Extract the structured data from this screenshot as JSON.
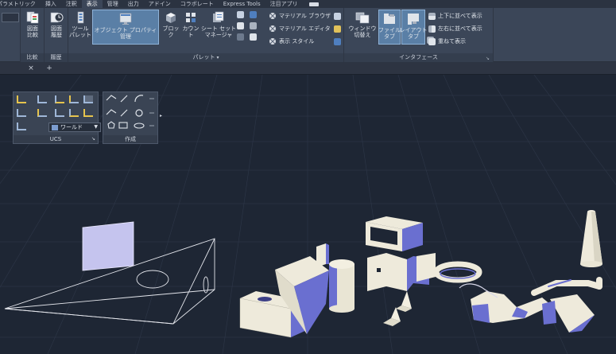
{
  "ribbon_tabs": [
    {
      "label": "パラメトリック",
      "active": false
    },
    {
      "label": "挿入",
      "active": false
    },
    {
      "label": "注釈",
      "active": false
    },
    {
      "label": "表示",
      "active": true
    },
    {
      "label": "管理",
      "active": false
    },
    {
      "label": "出力",
      "active": false
    },
    {
      "label": "アドイン",
      "active": false
    },
    {
      "label": "コラボレート",
      "active": false
    },
    {
      "label": "Express Tools",
      "active": false
    },
    {
      "label": "注目アプリ",
      "active": false
    }
  ],
  "panels": {
    "compare": {
      "title": "比較",
      "button": "図面\n比較"
    },
    "history": {
      "title": "履歴",
      "button": "図面\n履歴"
    },
    "palettes": {
      "title": "パレット",
      "tool_palette": "ツール\nパレット",
      "properties": "オブジェクト プロパティ管理",
      "block": "ブロック",
      "count": "カウント",
      "sheet_set": "シート セット\nマネージャ",
      "material_browser": "マテリアル ブラウザ",
      "material_editor": "マテリアル エディタ",
      "visual_styles": "表示 スタイル"
    },
    "interface": {
      "title": "インタフェース",
      "switch_windows": "ウィンドウ\n切替え",
      "file_tabs": "ファイル\nタブ",
      "layout_tabs": "レイアウト\nタブ",
      "tile_horizontal": "上下に並べて表示",
      "tile_vertical": "左右に並べて表示",
      "cascade": "重ねて表示"
    }
  },
  "file_tabs": {
    "close_icon": "×",
    "new_icon": "+"
  },
  "ucs_panel": {
    "title": "UCS",
    "dropdown_value": "ワールド"
  },
  "draw_panel": {
    "title": "作成"
  },
  "colors": {
    "canvas_bg": "#1e2634",
    "ribbon_bg": "#3b4658",
    "solid_light": "#eeeadb",
    "solid_shade": "#6a6fd0",
    "selected": "#5a7fa6"
  }
}
